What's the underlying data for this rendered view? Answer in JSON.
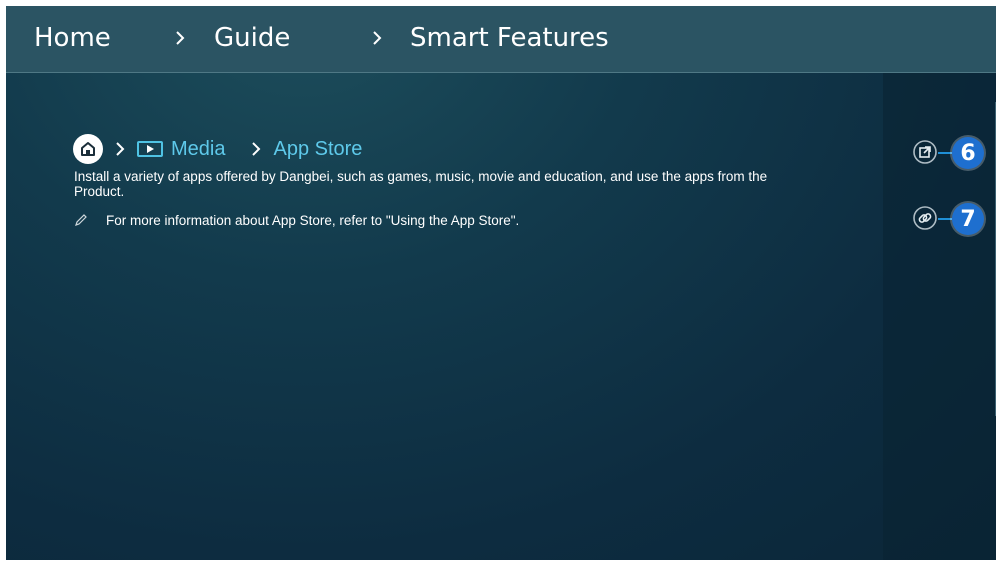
{
  "breadcrumb": {
    "items": [
      "Home",
      "Guide",
      "Smart Features"
    ]
  },
  "content": {
    "path": {
      "home_icon": "home-icon",
      "media_icon": "media-icon",
      "media_label": "Media",
      "app_store_label": "App Store"
    },
    "description": "Install a variety of apps offered by Dangbei, such as games, music, movie and education, and use the apps from the Product.",
    "note": "For more information about App Store, refer to \"Using the App Store\"."
  },
  "side_actions": {
    "open_icon": "open-external-icon",
    "link_icon": "link-icon",
    "callout_6": "6",
    "callout_7": "7"
  },
  "colors": {
    "accent_link": "#5ec9ea",
    "callout_badge": "#1e6fcf",
    "topbar": "#2b5463"
  }
}
